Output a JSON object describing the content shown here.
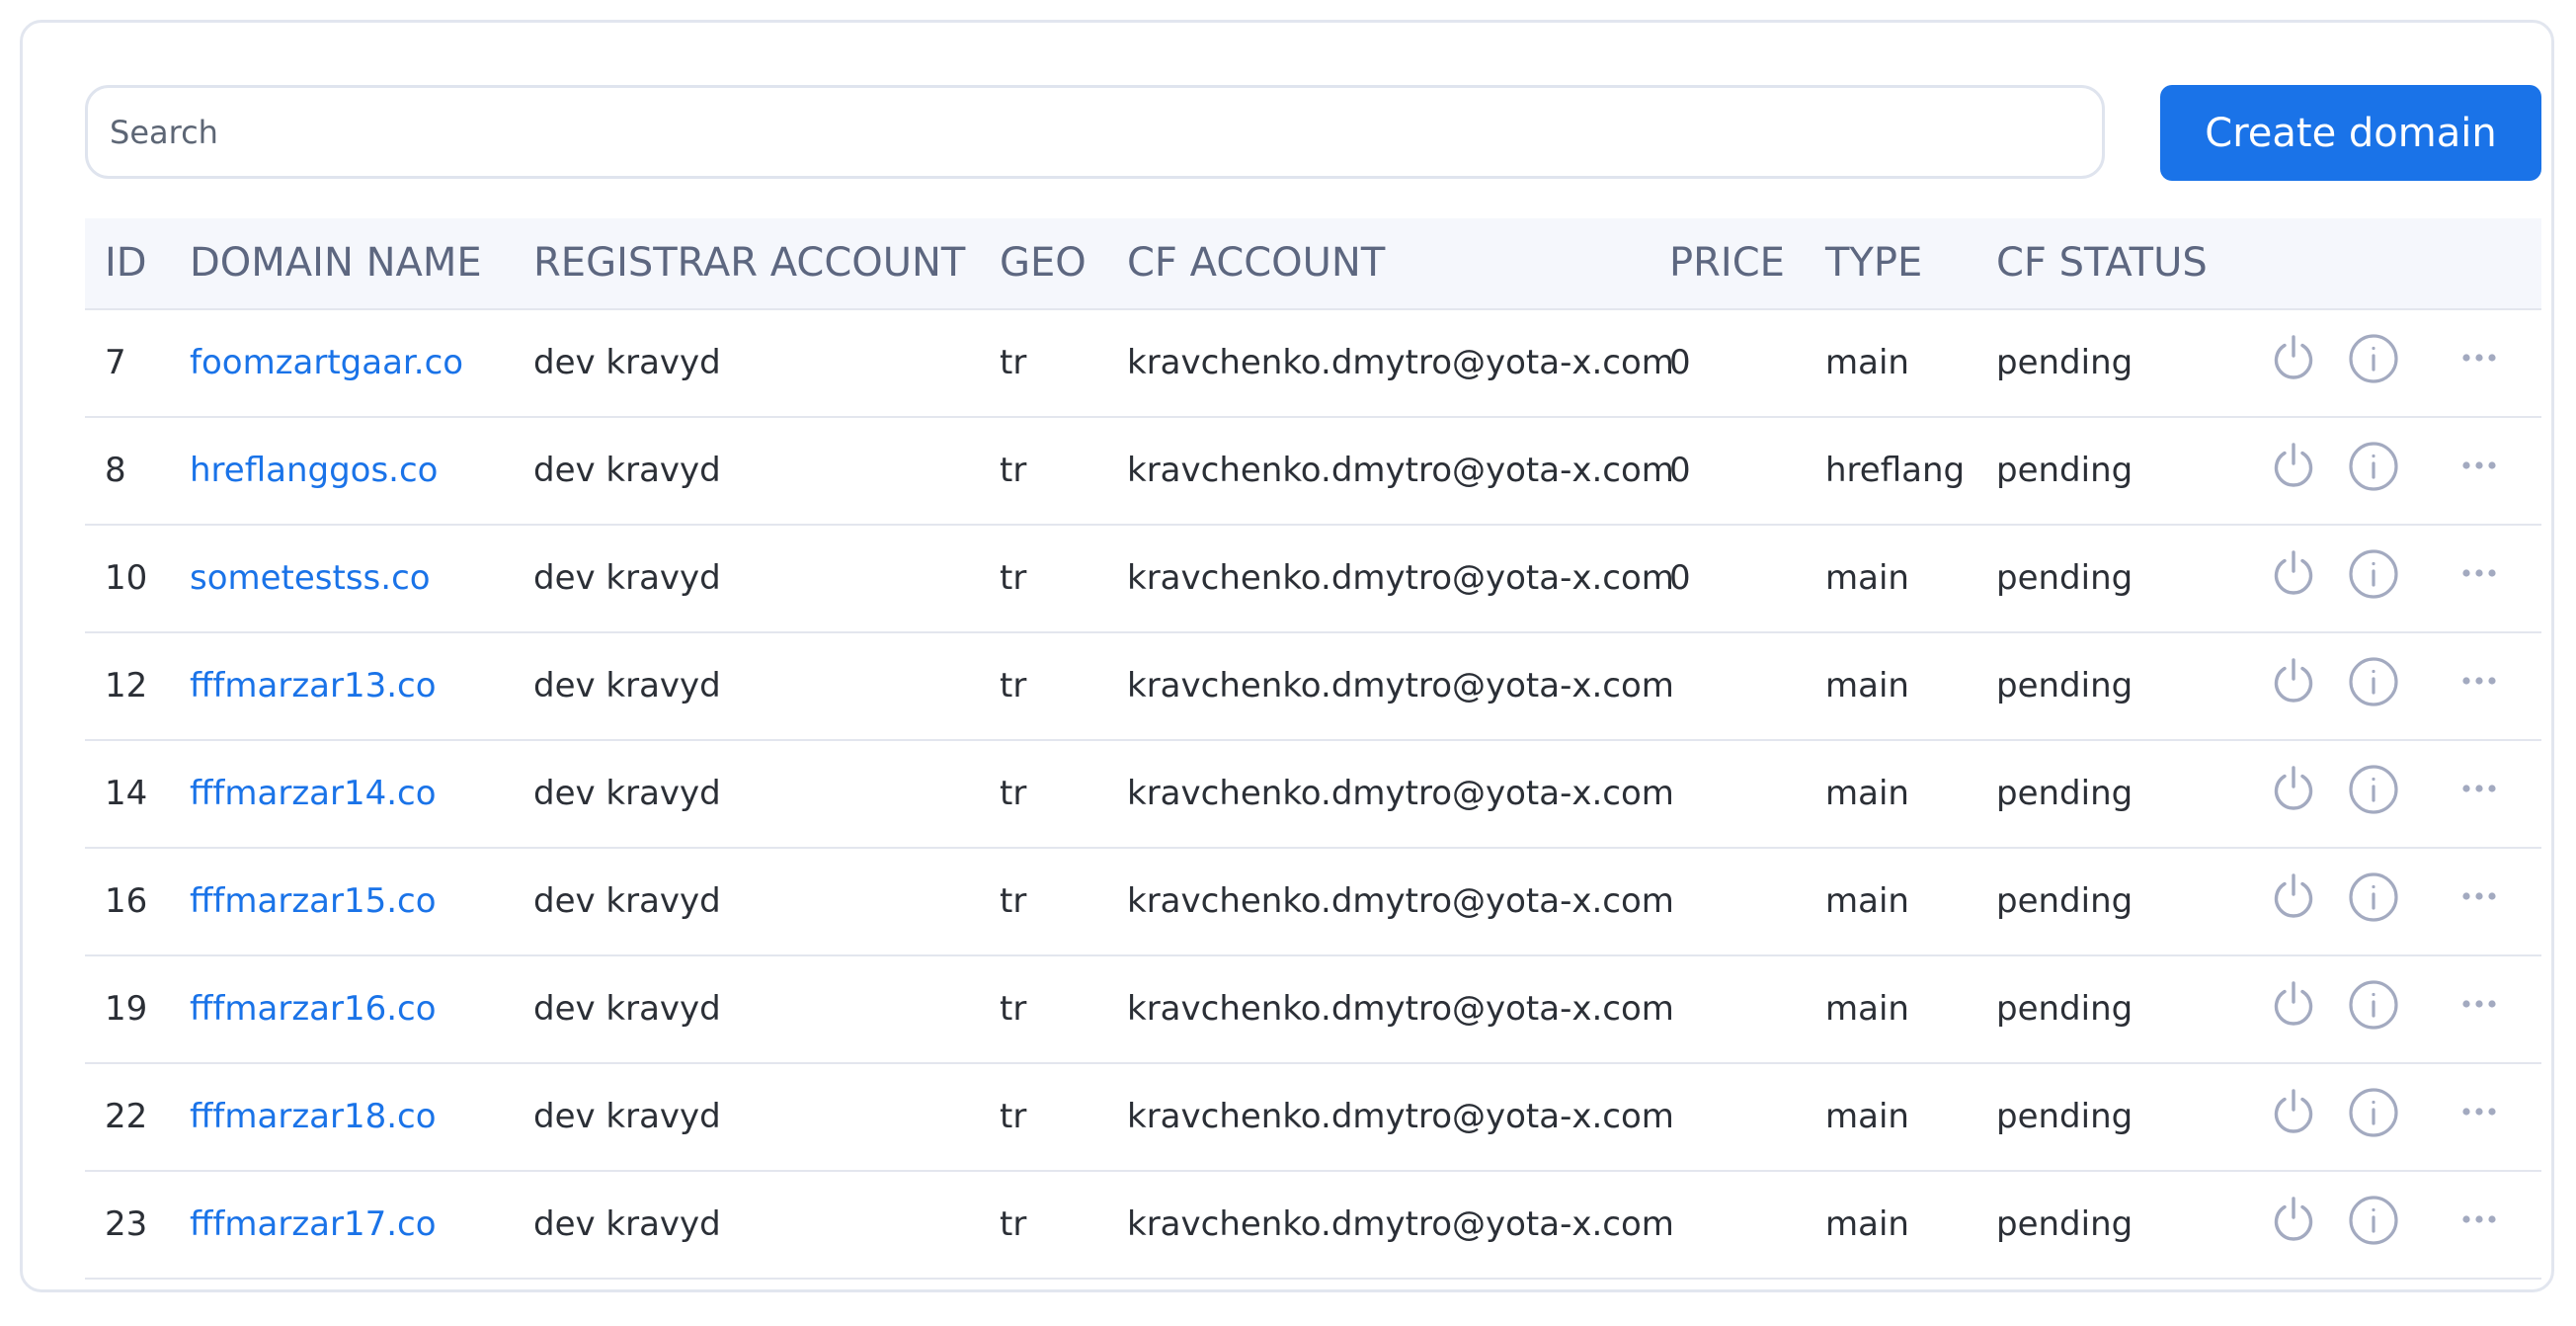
{
  "search": {
    "placeholder": "Search",
    "value": ""
  },
  "create_button": {
    "label": "Create domain"
  },
  "table": {
    "headers": {
      "id": "ID",
      "domain": "DOMAIN NAME",
      "registrar": "REGISTRAR ACCOUNT",
      "geo": "GEO",
      "cf_account": "CF ACCOUNT",
      "price": "PRICE",
      "type": "TYPE",
      "cf_status": "CF STATUS"
    },
    "rows": [
      {
        "id": "7",
        "domain": "foomzartgaar.co",
        "registrar": "dev kravyd",
        "geo": "tr",
        "cf_account": "kravchenko.dmytro@yota-x.com",
        "price": "0",
        "type": "main",
        "cf_status": "pending"
      },
      {
        "id": "8",
        "domain": "hreflanggos.co",
        "registrar": "dev kravyd",
        "geo": "tr",
        "cf_account": "kravchenko.dmytro@yota-x.com",
        "price": "0",
        "type": "hreflang",
        "cf_status": "pending"
      },
      {
        "id": "10",
        "domain": "sometestss.co",
        "registrar": "dev kravyd",
        "geo": "tr",
        "cf_account": "kravchenko.dmytro@yota-x.com",
        "price": "0",
        "type": "main",
        "cf_status": "pending"
      },
      {
        "id": "12",
        "domain": "fffmarzar13.co",
        "registrar": "dev kravyd",
        "geo": "tr",
        "cf_account": "kravchenko.dmytro@yota-x.com",
        "price": "",
        "type": "main",
        "cf_status": "pending"
      },
      {
        "id": "14",
        "domain": "fffmarzar14.co",
        "registrar": "dev kravyd",
        "geo": "tr",
        "cf_account": "kravchenko.dmytro@yota-x.com",
        "price": "",
        "type": "main",
        "cf_status": "pending"
      },
      {
        "id": "16",
        "domain": "fffmarzar15.co",
        "registrar": "dev kravyd",
        "geo": "tr",
        "cf_account": "kravchenko.dmytro@yota-x.com",
        "price": "",
        "type": "main",
        "cf_status": "pending"
      },
      {
        "id": "19",
        "domain": "fffmarzar16.co",
        "registrar": "dev kravyd",
        "geo": "tr",
        "cf_account": "kravchenko.dmytro@yota-x.com",
        "price": "",
        "type": "main",
        "cf_status": "pending"
      },
      {
        "id": "22",
        "domain": "fffmarzar18.co",
        "registrar": "dev kravyd",
        "geo": "tr",
        "cf_account": "kravchenko.dmytro@yota-x.com",
        "price": "",
        "type": "main",
        "cf_status": "pending"
      },
      {
        "id": "23",
        "domain": "fffmarzar17.co",
        "registrar": "dev kravyd",
        "geo": "tr",
        "cf_account": "kravchenko.dmytro@yota-x.com",
        "price": "",
        "type": "main",
        "cf_status": "pending"
      }
    ],
    "row_actions": [
      "power-icon",
      "info-icon",
      "more-horizontal-icon"
    ]
  },
  "colors": {
    "accent": "#1a73e8",
    "icon": "#a3aac0",
    "header_bg": "#f5f7fc",
    "border": "#e3e6ee"
  }
}
